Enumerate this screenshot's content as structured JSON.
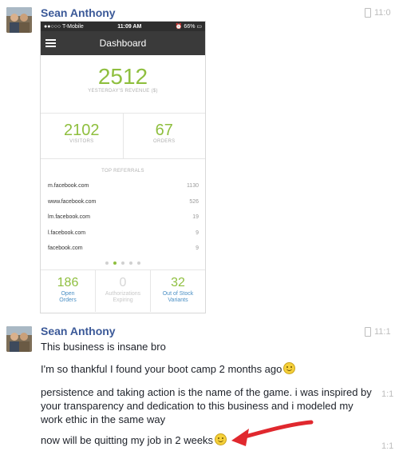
{
  "messages": [
    {
      "sender": "Sean Anthony",
      "time": "11:0"
    },
    {
      "sender": "Sean Anthony",
      "time": "11:1",
      "lines": [
        {
          "text": "This business is insane bro",
          "time": "",
          "emoji": ""
        },
        {
          "text": "I'm so thankful I found your boot camp 2 months ago",
          "time": "",
          "emoji": "smiley"
        },
        {
          "text": "persistence and taking action is the name of the game.  i was inspired by your transparency and dedication to this business and i modeled my work ethic in the same way",
          "time": "1:1",
          "emoji": ""
        },
        {
          "text": "now will be quitting my job in 2 weeks",
          "time": "1:1",
          "emoji": "smiley"
        }
      ]
    }
  ],
  "phone": {
    "carrier": "●●○○○ T-Mobile",
    "clock": "11:09 AM",
    "battery": "66%",
    "title": "Dashboard",
    "revenue": {
      "value": "2512",
      "label": "YESTERDAY'S REVENUE ($)"
    },
    "visitors": {
      "value": "2102",
      "label": "VISITORS"
    },
    "orders": {
      "value": "67",
      "label": "ORDERS"
    },
    "referrals_title": "TOP REFERRALS",
    "referrals": [
      {
        "site": "m.facebook.com",
        "count": "1130"
      },
      {
        "site": "www.facebook.com",
        "count": "526"
      },
      {
        "site": "lm.facebook.com",
        "count": "19"
      },
      {
        "site": "l.facebook.com",
        "count": "9"
      },
      {
        "site": "facebook.com",
        "count": "9"
      }
    ],
    "stats": [
      {
        "value": "186",
        "label": "Open Orders"
      },
      {
        "value": "0",
        "label": "Authorizations Expiring"
      },
      {
        "value": "32",
        "label": "Out of Stock Variants"
      }
    ]
  },
  "colors": {
    "accent_green": "#8fbf3f",
    "link_blue": "#3b5998",
    "arrow_red": "#e0282e"
  },
  "icons": [
    "phone-icon",
    "smiley-emoji",
    "hamburger-menu-icon",
    "red-arrow-annotation"
  ]
}
